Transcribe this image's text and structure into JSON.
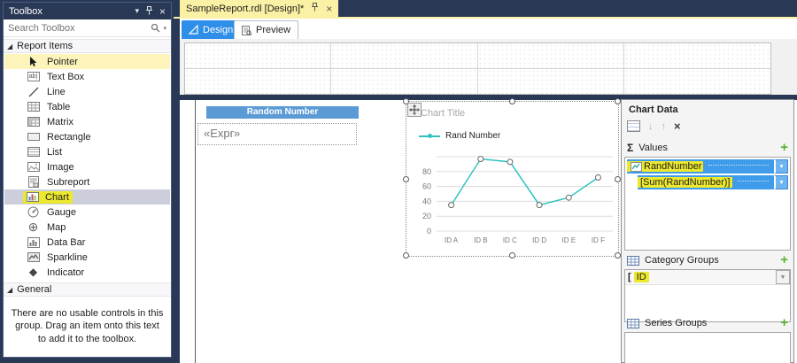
{
  "colors": {
    "chrome_navy": "#293955",
    "active_tab_yellow": "#FAF1A4",
    "highlight_marker": "#ECE82F",
    "selected_row_blue": "#3E9CEA",
    "design_tab_blue": "#2E8EE8",
    "table_header_blue": "#5B9BD5",
    "series_teal": "#2FC3BE",
    "plus_green": "#57B22F",
    "toolbox_selected_gray": "#CCCEDB",
    "toolbox_hot_yellow": "#FDF4BB"
  },
  "toolbox": {
    "title": "Toolbox",
    "search_placeholder": "Search Toolbox",
    "report_items_header": "Report Items",
    "general_header": "General",
    "items": [
      "Pointer",
      "Text Box",
      "Line",
      "Table",
      "Matrix",
      "Rectangle",
      "List",
      "Image",
      "Subreport",
      "Chart",
      "Gauge",
      "Map",
      "Data Bar",
      "Sparkline",
      "Indicator"
    ],
    "selected_item": "Chart",
    "empty_group_message": "There are no usable controls in this group. Drag an item onto this text to add it to the toolbox."
  },
  "document": {
    "tab_title": "SampleReport.rdl [Design]*",
    "design_tab": "Design",
    "preview_tab": "Preview"
  },
  "report": {
    "table_header": "Random Number",
    "expr_placeholder": "«Expr»"
  },
  "chart_data": {
    "type": "line",
    "title": "Chart Title",
    "categories": [
      "ID A",
      "ID B",
      "ID C",
      "ID D",
      "ID E",
      "ID F"
    ],
    "series": [
      {
        "name": "Rand Number",
        "color": "#2FC3BE",
        "values": [
          35,
          97,
          93,
          35,
          45,
          72
        ]
      }
    ],
    "yticks": [
      0,
      20,
      40,
      60,
      80
    ],
    "ylim": [
      0,
      100
    ],
    "grid": true,
    "legend_position": "top-left"
  },
  "chart_panel": {
    "title": "Chart Data",
    "sigma": "Σ",
    "values_section": "Values",
    "value_fields": [
      "RandNumber",
      "[Sum(RandNumber)]"
    ],
    "category_section": "Category Groups",
    "category_fields": [
      "ID"
    ],
    "series_section": "Series Groups"
  },
  "icons": {
    "collapse_triangle": "◢",
    "dropdown_arrow": "▼",
    "window_menu_arrow": "▾",
    "close": "×",
    "move_up": "↑",
    "move_down": "↓",
    "delete": "×",
    "add_plus": "+",
    "indicator_glyph": "◆",
    "map_glyph": "⊕",
    "open_bracket_group": "["
  }
}
